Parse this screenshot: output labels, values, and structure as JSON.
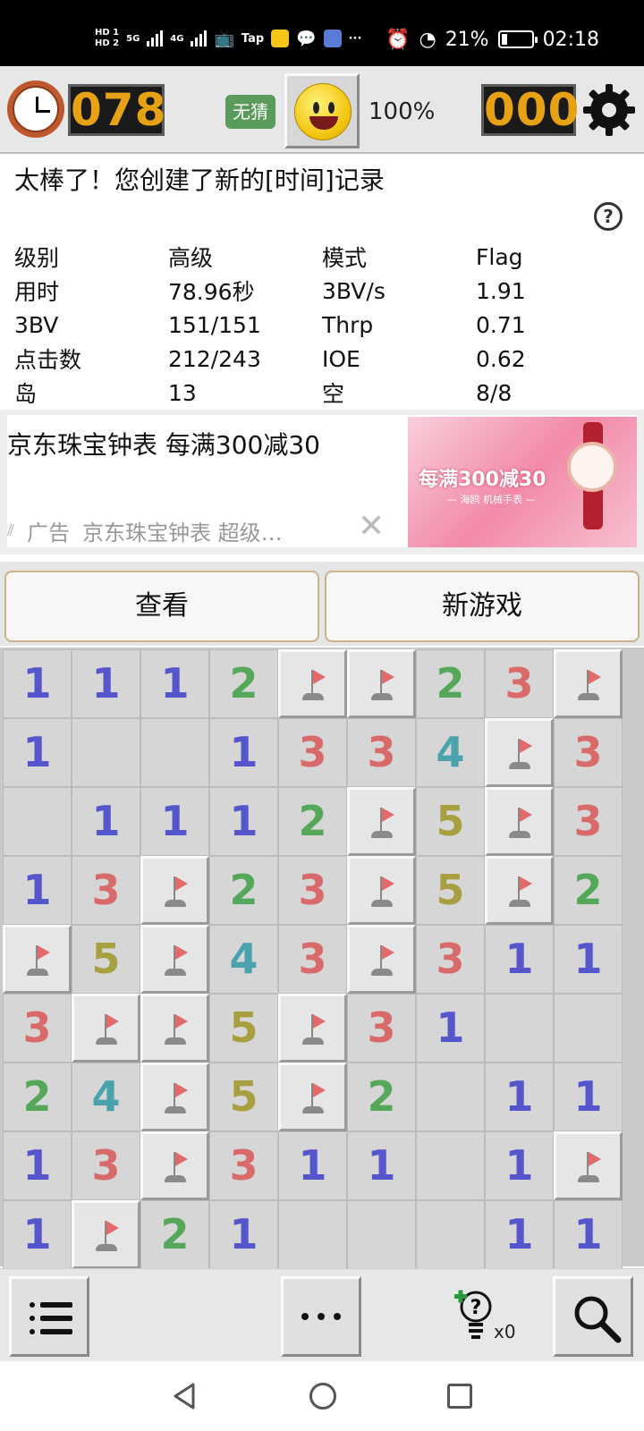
{
  "statusbar": {
    "hd1": "HD 1",
    "hd2": "HD 2",
    "net1": "5G",
    "net2": "4G",
    "tap": "Tap",
    "more": "···",
    "battery_percent": "21%",
    "battery_level": 0.21,
    "time": "02:18"
  },
  "game": {
    "timer": "078",
    "no_guess": "无猜",
    "percent": "100%",
    "mines_left": "000"
  },
  "message": "太棒了！您创建了新的[时间]记录",
  "help": "?",
  "stats": [
    [
      "级别",
      "高级",
      "模式",
      "Flag"
    ],
    [
      "用时",
      "78.96秒",
      "3BV/s",
      "1.91"
    ],
    [
      "3BV",
      "151/151",
      "Thrp",
      "0.71"
    ],
    [
      "点击数",
      "212/243",
      "IOE",
      "0.62"
    ],
    [
      "岛",
      "13",
      "空",
      "8/8"
    ]
  ],
  "ad": {
    "title": "京东珠宝钟表 每满300减30",
    "label": "广告",
    "desc": "京东珠宝钟表 超级…",
    "close": "✕",
    "banner": "每满300减30",
    "banner_sub": "— 海鸥 机械手表 —"
  },
  "buttons": {
    "view": "查看",
    "new_game": "新游戏"
  },
  "board": [
    [
      "1",
      "1",
      "1",
      "2",
      "F",
      "F",
      "2",
      "3",
      "F"
    ],
    [
      "1",
      "",
      "",
      "1",
      "3",
      "3",
      "4",
      "F",
      "3"
    ],
    [
      "",
      "1",
      "1",
      "1",
      "2",
      "F",
      "5",
      "F",
      "3"
    ],
    [
      "1",
      "3",
      "F",
      "2",
      "3",
      "F",
      "5",
      "F",
      "2"
    ],
    [
      "F",
      "5",
      "F",
      "4",
      "3",
      "F",
      "3",
      "1",
      "1"
    ],
    [
      "3",
      "F",
      "F",
      "5",
      "F",
      "3",
      "1",
      "",
      ""
    ],
    [
      "2",
      "4",
      "F",
      "5",
      "F",
      "2",
      "",
      "1",
      "1"
    ],
    [
      "1",
      "3",
      "F",
      "3",
      "1",
      "1",
      "",
      "1",
      "F"
    ],
    [
      "1",
      "F",
      "2",
      "1",
      "",
      "",
      "",
      "1",
      "1"
    ]
  ],
  "toolbar": {
    "hint_count": "x0"
  }
}
